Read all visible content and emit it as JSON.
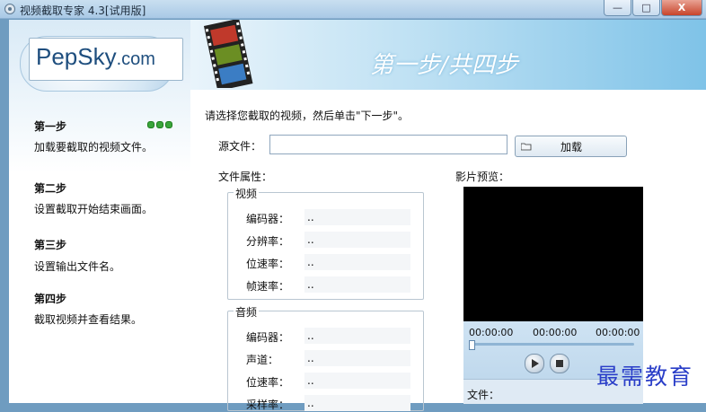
{
  "window": {
    "title": "视频截取专家 4.3[试用版]",
    "controls": {
      "minimize": "—",
      "maximize": "□",
      "close": "X"
    }
  },
  "sidebar": {
    "logo": "PepSky",
    "logo_suffix": ".com",
    "steps": [
      {
        "title": "第一步",
        "desc": "加载要截取的视频文件。",
        "active": true
      },
      {
        "title": "第二步",
        "desc": "设置截取开始结束画面。",
        "active": false
      },
      {
        "title": "第三步",
        "desc": "设置输出文件名。",
        "active": false
      },
      {
        "title": "第四步",
        "desc": "截取视频并查看结果。",
        "active": false
      }
    ]
  },
  "header": {
    "step_title": "第一步/共四步"
  },
  "main": {
    "instruction": "请选择您截取的视频，然后单击\"下一步\"。",
    "source_label": "源文件：",
    "source_value": "",
    "load_button": "加载",
    "props_label": "文件属性：",
    "video_group": {
      "title": "视频",
      "rows": [
        {
          "label": "编码器：",
          "value": ".."
        },
        {
          "label": "分辨率：",
          "value": ".."
        },
        {
          "label": "位速率：",
          "value": ".."
        },
        {
          "label": "帧速率：",
          "value": ".."
        }
      ]
    },
    "audio_group": {
      "title": "音频",
      "rows": [
        {
          "label": "编码器：",
          "value": ".."
        },
        {
          "label": "声道：",
          "value": ".."
        },
        {
          "label": "位速率：",
          "value": ".."
        },
        {
          "label": "采样率：",
          "value": ".."
        }
      ]
    },
    "preview": {
      "label": "影片预览：",
      "time_start": "00:00:00",
      "time_current": "00:00:00",
      "time_end": "00:00:00",
      "position": 0,
      "file_label": "文件："
    }
  },
  "watermark": "最需教育",
  "colors": {
    "accent": "#3aa53a",
    "header_blue": "#7fc3e8",
    "watermark": "#2a3ec8"
  }
}
